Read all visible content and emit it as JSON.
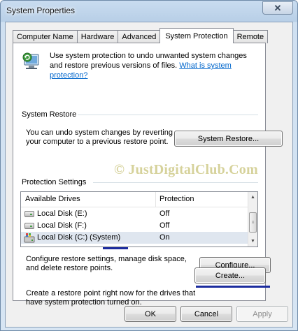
{
  "window": {
    "title": "System Properties",
    "close_glyph": "✕"
  },
  "tabs": [
    {
      "label": "Computer Name",
      "active": false
    },
    {
      "label": "Hardware",
      "active": false
    },
    {
      "label": "Advanced",
      "active": false
    },
    {
      "label": "System Protection",
      "active": true
    },
    {
      "label": "Remote",
      "active": false
    }
  ],
  "intro": {
    "icon": "system-protection-icon",
    "text": "Use system protection to undo unwanted system changes and restore previous versions of files.",
    "link": "What is system protection?"
  },
  "system_restore": {
    "group_label": "System Restore",
    "description": "You can undo system changes by reverting your computer to a previous restore point.",
    "button": "System Restore..."
  },
  "watermark": "© JustDigitalClub.Com",
  "protection": {
    "group_label": "Protection Settings",
    "columns": [
      "Available Drives",
      "Protection"
    ],
    "drives": [
      {
        "name": "Local Disk (E:)",
        "protection": "Off",
        "icon": "disk-icon"
      },
      {
        "name": "Local Disk (F:)",
        "protection": "Off",
        "icon": "disk-icon"
      },
      {
        "name": "Local Disk (C:) (System)",
        "protection": "On",
        "icon": "system-disk-icon",
        "selected": true
      }
    ],
    "configure_text": "Configure restore settings, manage disk space, and delete restore points.",
    "configure_button": "Configure...",
    "create_text": "Create a restore point right now for the drives that have system protection turned on.",
    "create_button": "Create..."
  },
  "footer": {
    "ok": "OK",
    "cancel": "Cancel",
    "apply": "Apply"
  },
  "colors": {
    "annotation_underline": "#1b2b9e",
    "link": "#0066cc",
    "watermark": "#d6d29b"
  }
}
